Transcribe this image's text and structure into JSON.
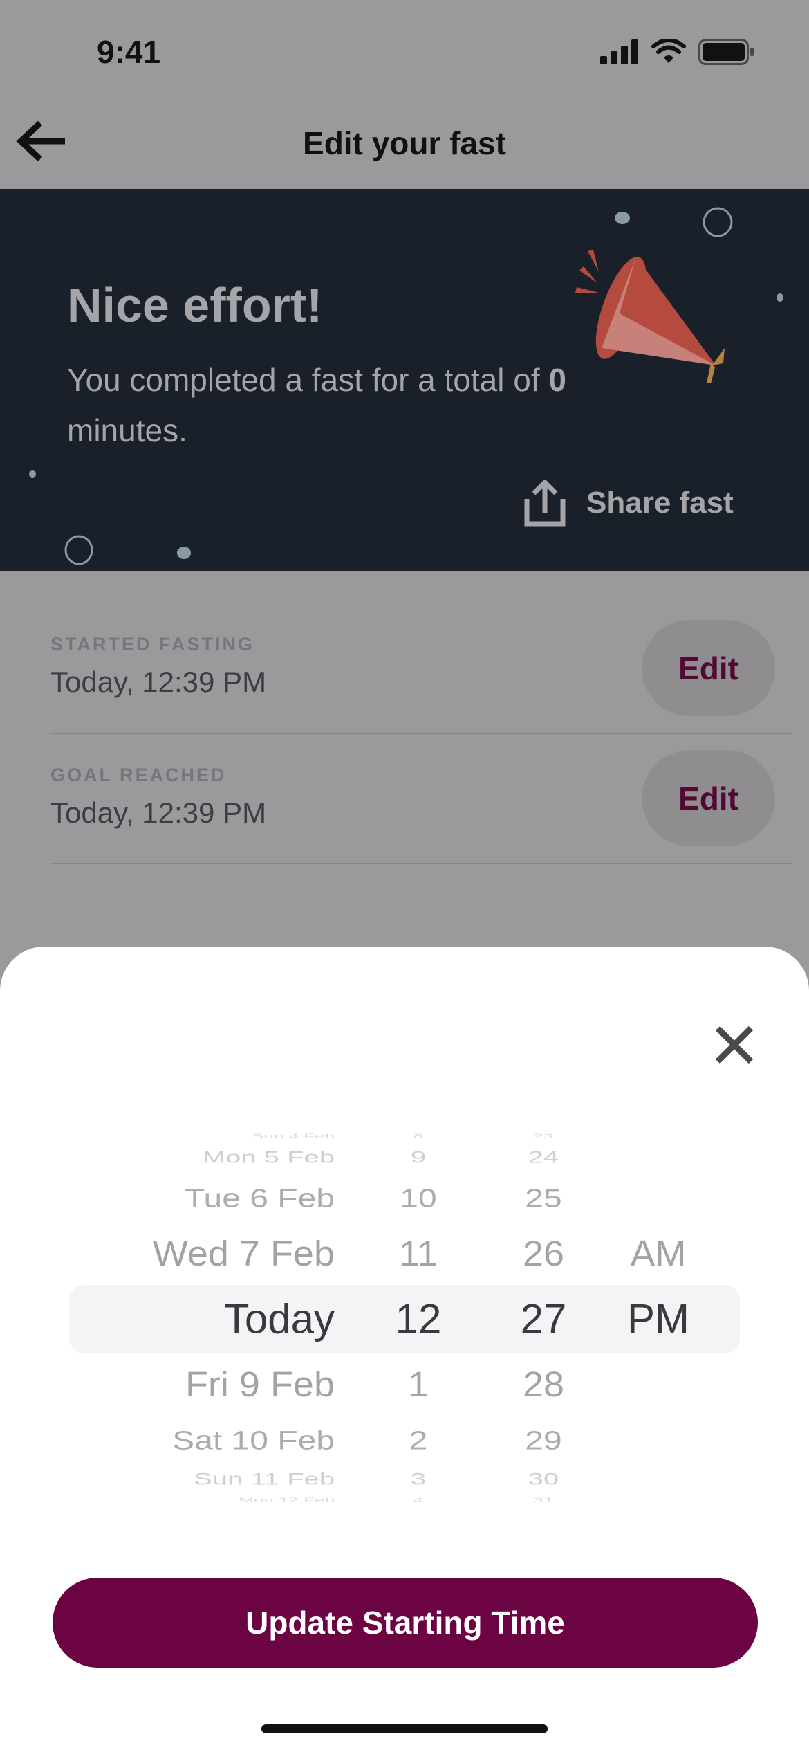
{
  "status_bar": {
    "time": "9:41"
  },
  "header": {
    "title": "Edit your fast",
    "back_icon": "arrow-left-icon"
  },
  "banner": {
    "title": "Nice effort!",
    "text_prefix": "You completed a fast for a total of ",
    "total_value": "0",
    "text_suffix": "minutes.",
    "share_label": "Share fast",
    "colors": {
      "background": "#1a202a",
      "party_popper": "#b54a3e"
    }
  },
  "rows": [
    {
      "label": "STARTED FASTING",
      "value": "Today, 12:39 PM",
      "edit_label": "Edit"
    },
    {
      "label": "GOAL REACHED",
      "value": "Today, 12:39 PM",
      "edit_label": "Edit"
    }
  ],
  "picker": {
    "dates": [
      "Sun 4 Feb",
      "Mon 5 Feb",
      "Tue 6 Feb",
      "Wed 7 Feb",
      "Today",
      "Fri 9 Feb",
      "Sat 10 Feb",
      "Sun 11 Feb",
      "Mon 12 Feb"
    ],
    "hours": [
      "8",
      "9",
      "10",
      "11",
      "12",
      "1",
      "2",
      "3",
      "4"
    ],
    "minutes": [
      "23",
      "24",
      "25",
      "26",
      "27",
      "28",
      "29",
      "30",
      "31"
    ],
    "ampm": [
      "AM",
      "PM"
    ],
    "selected": {
      "date": "Today",
      "hour": "12",
      "minute": "27",
      "ampm": "PM"
    }
  },
  "update_button": "Update Starting Time",
  "accent_color": "#6c0342"
}
